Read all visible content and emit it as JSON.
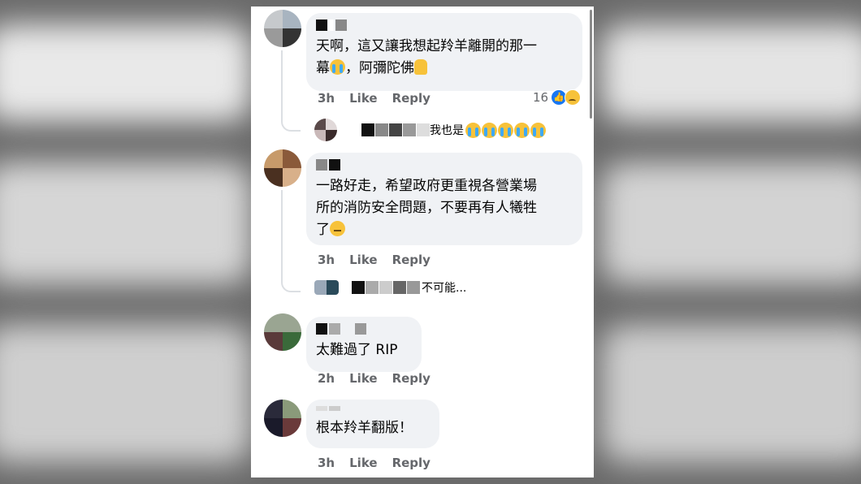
{
  "comments": [
    {
      "text": "天啊，這又讓我想起羚羊離開的那一\n幕",
      "text2": "，阿彌陀佛",
      "time": "3h",
      "like_label": "Like",
      "reply_label": "Reply",
      "reaction_count": "16",
      "reply_preview": {
        "text": "我也是",
        "emoji_count": 5
      }
    },
    {
      "text": "一路好走，希望政府更重視各營業場\n所的消防安全問題，不要再有人犧牲\n了",
      "time": "3h",
      "like_label": "Like",
      "reply_label": "Reply",
      "reply_preview": {
        "text": "不可能..."
      }
    },
    {
      "text": "太難過了 RIP",
      "time": "2h",
      "like_label": "Like",
      "reply_label": "Reply"
    },
    {
      "text": "根本羚羊翻版！",
      "time": "3h",
      "like_label": "Like",
      "reply_label": "Reply"
    }
  ],
  "icons": {
    "crying": "loudly-crying-face-emoji",
    "pray": "folded-hands-emoji",
    "pensive": "pensive-face-emoji",
    "like_reaction": "thumbs-up-reaction-icon",
    "sad_reaction": "sad-reaction-icon"
  },
  "colors": {
    "bubble": "#f0f2f5",
    "meta_text": "#65676b",
    "like_blue": "#1877f2"
  }
}
